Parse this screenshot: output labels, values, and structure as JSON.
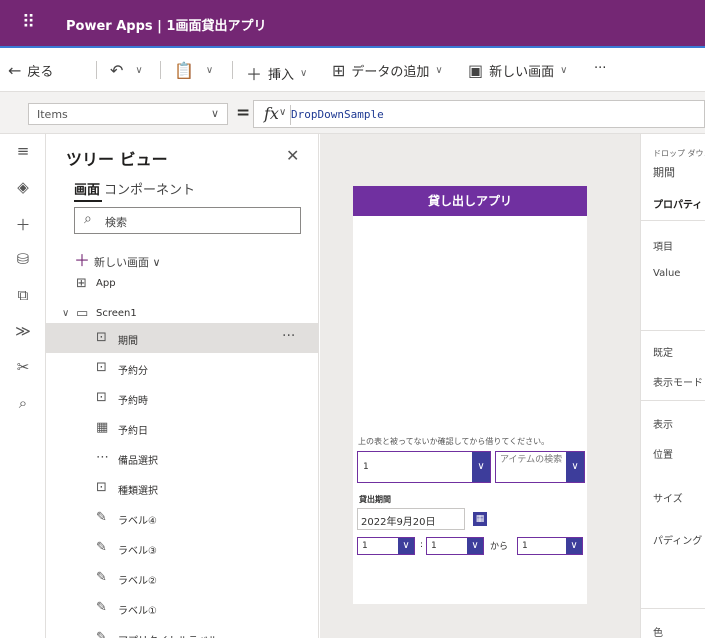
{
  "header": {
    "waffle_glyph": "⠿",
    "title": "Power Apps | 1画面貸出アプリ"
  },
  "commandbar": {
    "back_label": "戻る",
    "insert_label": "挿入",
    "add_data_label": "データの追加",
    "new_screen_label": "新しい画面",
    "more_glyph": "···"
  },
  "formulabar": {
    "property": "Items",
    "equals": "=",
    "fx": "fx",
    "formula": "DropDownSample"
  },
  "tree": {
    "title": "ツリー ビュー",
    "tab_screens": "画面",
    "tab_components": "コンポーネント",
    "search_placeholder": "検索",
    "new_screen": "新しい画面",
    "app_label": "App",
    "screen_label": "Screen1",
    "items": [
      {
        "label": "期間",
        "icon": "dropdown-icon",
        "selected": true
      },
      {
        "label": "予約分",
        "icon": "dropdown-icon"
      },
      {
        "label": "予約時",
        "icon": "dropdown-icon"
      },
      {
        "label": "予約日",
        "icon": "calendar-icon"
      },
      {
        "label": "備品選択",
        "icon": "combobox-icon"
      },
      {
        "label": "種類選択",
        "icon": "dropdown-icon"
      },
      {
        "label": "ラベル④",
        "icon": "label-icon"
      },
      {
        "label": "ラベル③",
        "icon": "label-icon"
      },
      {
        "label": "ラベル②",
        "icon": "label-icon"
      },
      {
        "label": "ラベル①",
        "icon": "label-icon"
      },
      {
        "label": "アプリタイトルラベル",
        "icon": "label-icon"
      }
    ]
  },
  "phone": {
    "header": "貸し出しアプリ",
    "instruction": "上の表と被ってないか確認してから借りてください。",
    "dropdown1_value": "1",
    "combo_placeholder": "アイテムの検索",
    "period_label": "貸出期間",
    "date_value": "2022年9月20日",
    "dd_a": "1",
    "colon": ":",
    "dd_b": "1",
    "kara": "から",
    "dd_c": "1"
  },
  "props": {
    "control_type": "ドロップ ダウン",
    "control_name": "期間",
    "tab_properties": "プロパティ",
    "item": "項目",
    "value": "Value",
    "default": "既定",
    "display_mode": "表示モード",
    "visible": "表示",
    "position": "位置",
    "size": "サイズ",
    "padding": "パディング",
    "color": "色"
  },
  "colors": {
    "brand": "#742774",
    "app_header": "#7030a0",
    "dropdown_button": "#3d3d9b"
  }
}
